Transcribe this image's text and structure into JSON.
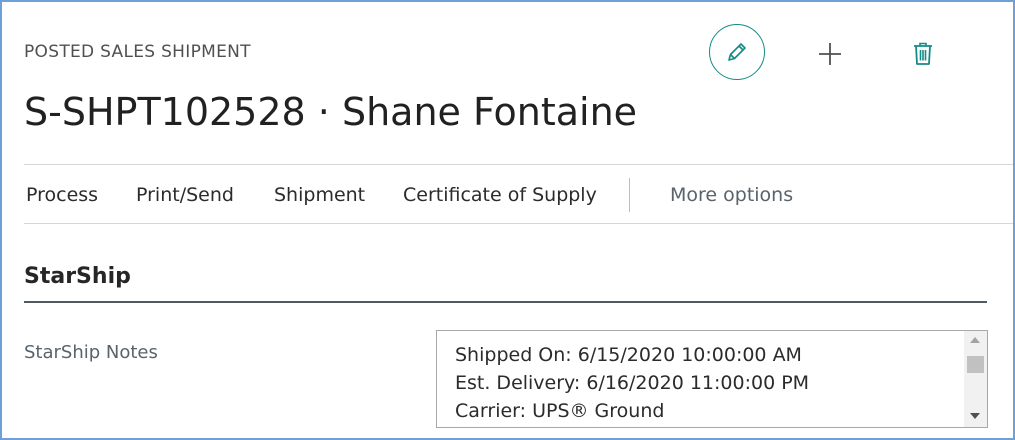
{
  "header": {
    "caption": "POSTED SALES SHIPMENT",
    "title": "S-SHPT102528 · Shane Fontaine"
  },
  "actions": [
    {
      "name": "edit",
      "icon": "pencil-icon"
    },
    {
      "name": "new",
      "icon": "plus-icon"
    },
    {
      "name": "delete",
      "icon": "trash-icon"
    }
  ],
  "menu": {
    "items": [
      "Process",
      "Print/Send",
      "Shipment",
      "Certificate of Supply"
    ],
    "more": "More options"
  },
  "section": {
    "title": "StarShip"
  },
  "notes": {
    "label": "StarShip Notes",
    "lines": [
      "Shipped On: 6/15/2020 10:00:00 AM",
      "Est. Delivery: 6/16/2020 11:00:00 PM",
      "Carrier: UPS® Ground"
    ]
  },
  "colors": {
    "accent": "#138b87",
    "frame": "#6f9fd8"
  }
}
